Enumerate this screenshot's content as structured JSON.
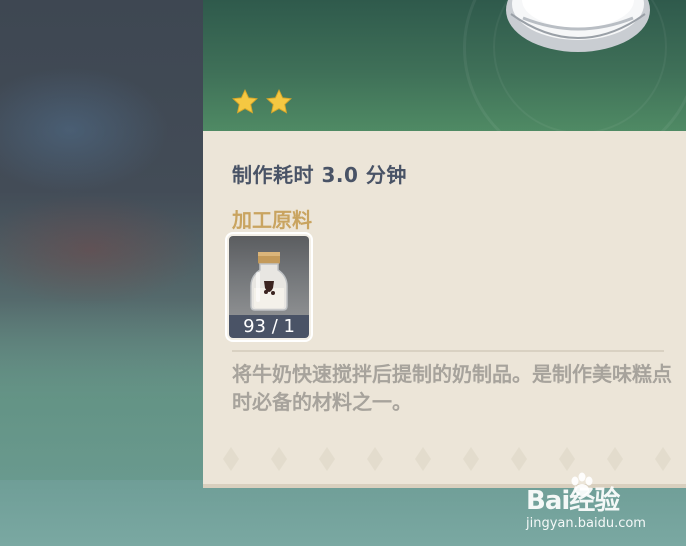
{
  "item": {
    "rarity_stars": 2,
    "craft_time": "制作耗时 3.0 分钟",
    "materials_title": "加工原料",
    "materials": [
      {
        "icon": "milk-bottle-icon",
        "count": "93 / 1"
      }
    ],
    "description": "将牛奶快速搅拌后提制的奶制品。是制作美味糕点时必备的材料之一。"
  },
  "watermark": {
    "logo": "Bai经验",
    "url": "jingyan.baidu.com"
  },
  "colors": {
    "header_green": "#3f7058",
    "panel_bg": "#ece5d8",
    "title_gold": "#c9a460",
    "text_dark": "#495366",
    "desc_grey": "#a7a39c",
    "star": "#f5c842"
  }
}
